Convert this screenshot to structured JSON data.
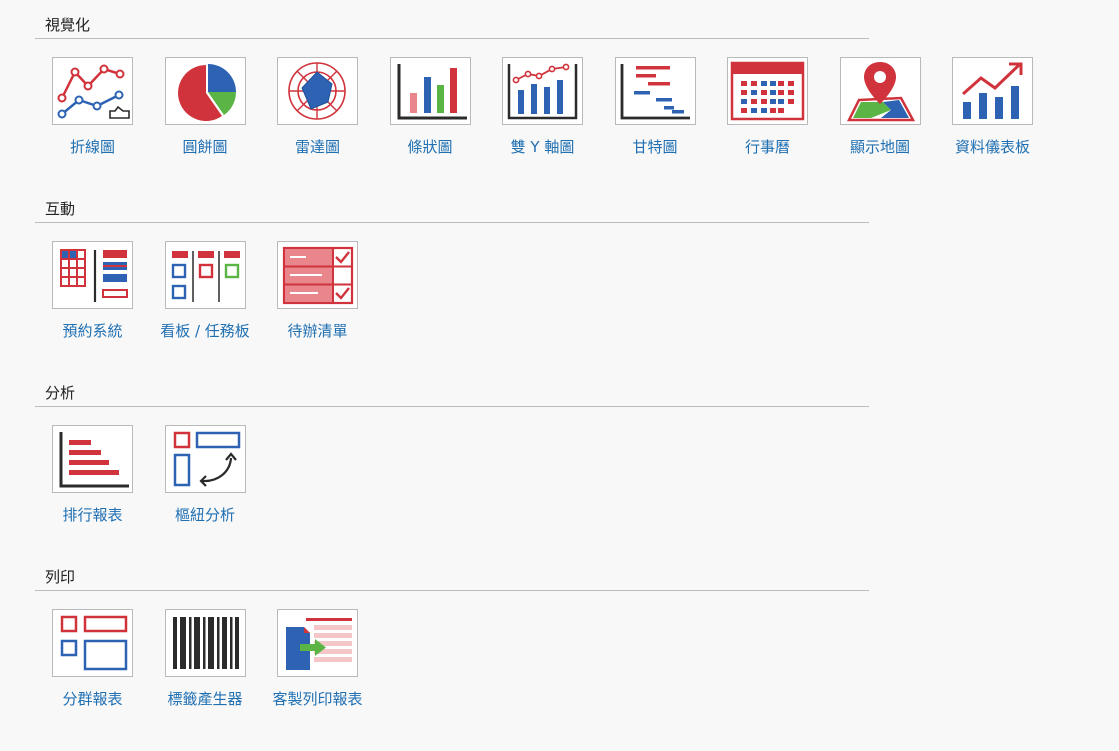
{
  "colors": {
    "red": "#d0333b",
    "blue": "#2e63b3",
    "green": "#5ab545",
    "dark": "#2b2b2b",
    "link": "#1f6fb2"
  },
  "sections": [
    {
      "title": "視覺化",
      "items": [
        {
          "label": "折線圖",
          "icon": "line-chart-icon"
        },
        {
          "label": "圓餅圖",
          "icon": "pie-chart-icon"
        },
        {
          "label": "雷達圖",
          "icon": "radar-chart-icon"
        },
        {
          "label": "條狀圖",
          "icon": "bar-chart-icon"
        },
        {
          "label": "雙 Y 軸圖",
          "icon": "dual-axis-chart-icon"
        },
        {
          "label": "甘特圖",
          "icon": "gantt-chart-icon"
        },
        {
          "label": "行事曆",
          "icon": "calendar-icon"
        },
        {
          "label": "顯示地圖",
          "icon": "map-icon"
        },
        {
          "label": "資料儀表板",
          "icon": "dashboard-icon"
        }
      ]
    },
    {
      "title": "互動",
      "items": [
        {
          "label": "預約系統",
          "icon": "booking-system-icon"
        },
        {
          "label": "看板 / 任務板",
          "icon": "kanban-board-icon"
        },
        {
          "label": "待辦清單",
          "icon": "todo-list-icon"
        }
      ]
    },
    {
      "title": "分析",
      "items": [
        {
          "label": "排行報表",
          "icon": "ranking-report-icon"
        },
        {
          "label": "樞紐分析",
          "icon": "pivot-analysis-icon"
        }
      ]
    },
    {
      "title": "列印",
      "items": [
        {
          "label": "分群報表",
          "icon": "grouped-report-icon"
        },
        {
          "label": "標籤產生器",
          "icon": "label-generator-icon"
        },
        {
          "label": "客製列印報表",
          "icon": "custom-print-report-icon"
        }
      ]
    }
  ]
}
